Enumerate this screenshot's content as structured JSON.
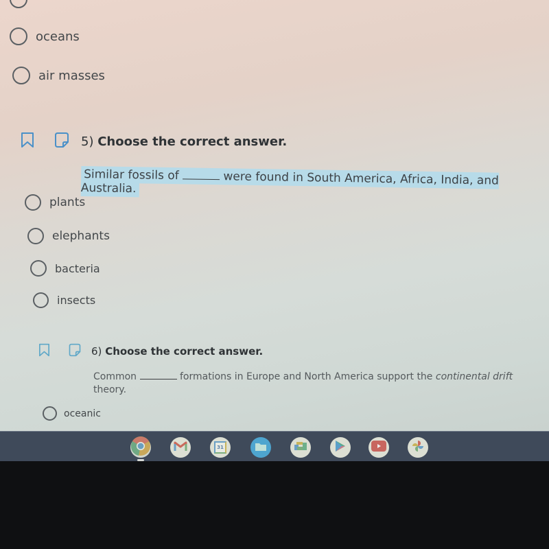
{
  "previous_question": {
    "options": [
      {
        "label": ""
      },
      {
        "label": "oceans"
      },
      {
        "label": "air masses"
      }
    ]
  },
  "question5": {
    "number": "5)",
    "title": "Choose the correct answer.",
    "prompt_before": "Similar fossils of",
    "prompt_after": "were found in South America, Africa, India, and Australia.",
    "options": [
      {
        "label": "plants"
      },
      {
        "label": "elephants"
      },
      {
        "label": "bacteria"
      },
      {
        "label": "insects"
      }
    ]
  },
  "question6": {
    "number": "6)",
    "title": "Choose the correct answer.",
    "prompt_before": "Common",
    "prompt_after_1": "formations in Europe and North America support the",
    "prompt_italic": "continental drift",
    "prompt_after_2": "theory.",
    "options": [
      {
        "label": "oceanic"
      }
    ]
  },
  "shelf": {
    "apps": [
      {
        "name": "Chrome",
        "icon": "chrome-icon",
        "active": true
      },
      {
        "name": "Gmail",
        "icon": "gmail-icon"
      },
      {
        "name": "Calendar",
        "icon": "calendar-icon",
        "text": "31"
      },
      {
        "name": "Files",
        "icon": "files-icon"
      },
      {
        "name": "Slides",
        "icon": "slides-icon"
      },
      {
        "name": "Play Store",
        "icon": "play-store-icon"
      },
      {
        "name": "YouTube",
        "icon": "youtube-icon"
      },
      {
        "name": "Photos",
        "icon": "photos-icon"
      }
    ]
  },
  "colors": {
    "highlight": "#b7dbe9",
    "icon_blue": "#4a90c8",
    "shelf": "#3f4a5a"
  }
}
